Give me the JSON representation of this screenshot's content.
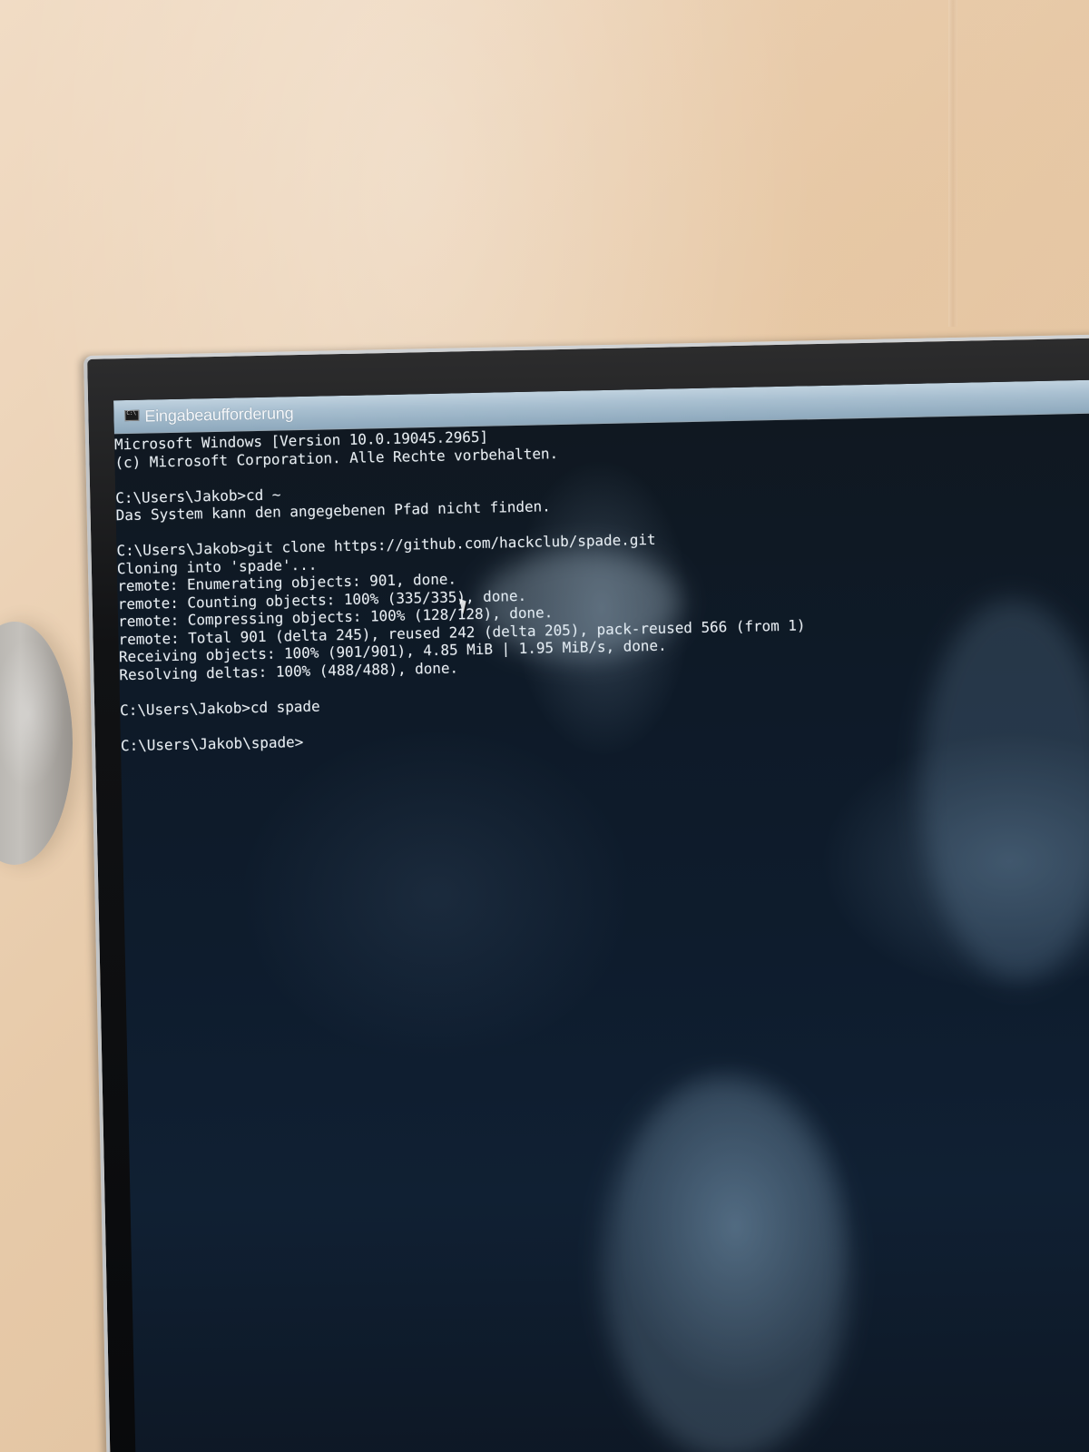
{
  "window": {
    "title": "Eingabeaufforderung",
    "title_icon": "command-prompt-icon"
  },
  "console": {
    "lines": [
      "Microsoft Windows [Version 10.0.19045.2965]",
      "(c) Microsoft Corporation. Alle Rechte vorbehalten.",
      "",
      "C:\\Users\\Jakob>cd ~",
      "Das System kann den angegebenen Pfad nicht finden.",
      "",
      "C:\\Users\\Jakob>git clone https://github.com/hackclub/spade.git",
      "Cloning into 'spade'...",
      "remote: Enumerating objects: 901, done.",
      "remote: Counting objects: 100% (335/335), done.",
      "remote: Compressing objects: 100% (128/128), done.",
      "remote: Total 901 (delta 245), reused 242 (delta 205), pack-reused 566 (from 1)",
      "Receiving objects: 100% (901/901), 4.85 MiB | 1.95 MiB/s, done.",
      "Resolving deltas: 100% (488/488), done.",
      "",
      "C:\\Users\\Jakob>cd spade",
      "",
      "C:\\Users\\Jakob\\spade>"
    ]
  },
  "colors": {
    "console_text": "#e7edf2",
    "console_background": "#0e1c2d",
    "titlebar": "#a8bfd0"
  }
}
